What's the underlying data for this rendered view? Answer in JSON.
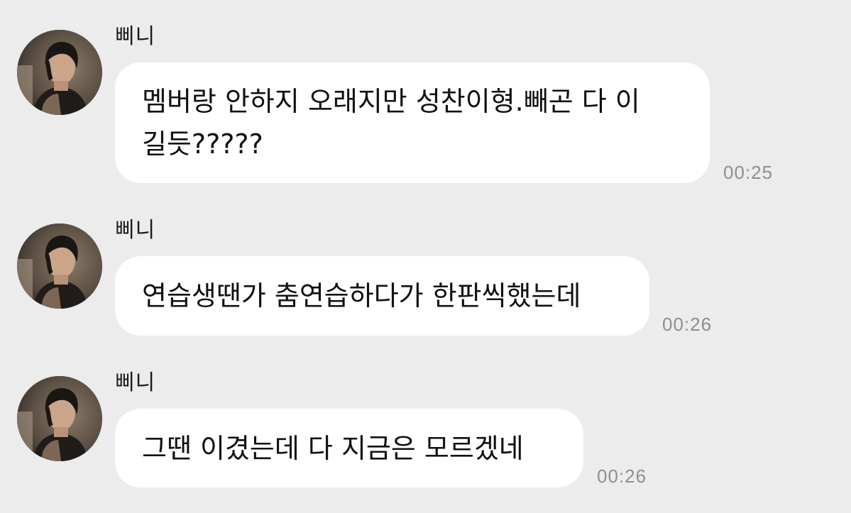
{
  "chat": {
    "messages": [
      {
        "sender": "삐니",
        "avatar_icon": "profile-photo",
        "text": "멤버랑 안하지 오래지만 성찬이형.빼곤 다 이\n길듯?????",
        "time": "00:25"
      },
      {
        "sender": "삐니",
        "avatar_icon": "profile-photo",
        "text": "연습생땐가 춤연습하다가 한판씩했는데",
        "time": "00:26"
      },
      {
        "sender": "삐니",
        "avatar_icon": "profile-photo",
        "text": "그땐 이겼는데 다 지금은 모르겠네",
        "time": "00:26"
      }
    ]
  },
  "colors": {
    "background": "#ececec",
    "bubble": "#ffffff",
    "text": "#111111",
    "timestamp": "#8f8f8f"
  }
}
